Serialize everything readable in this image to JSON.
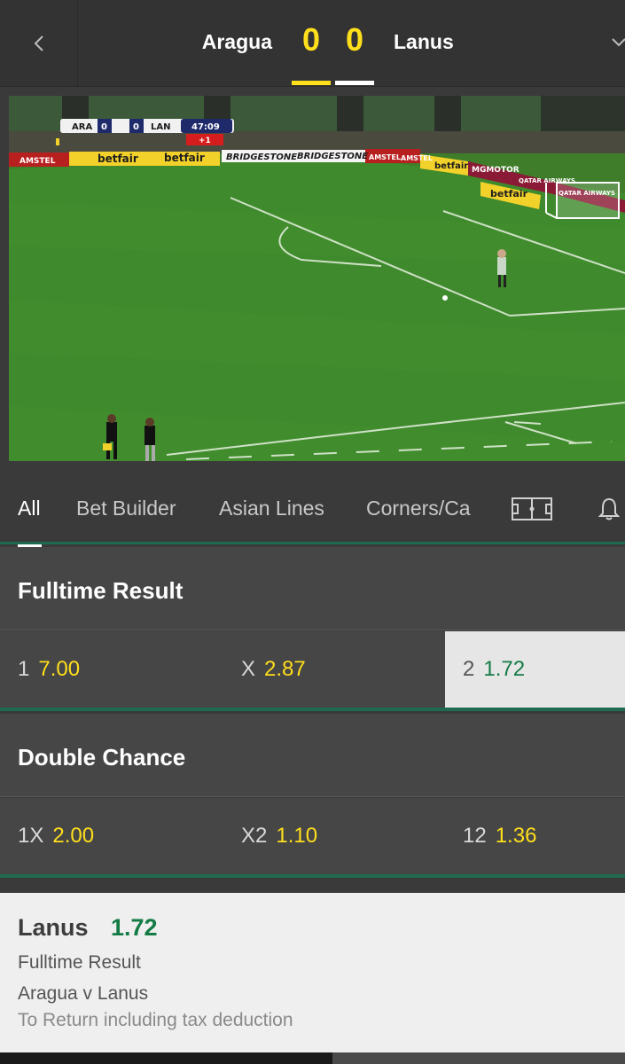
{
  "match": {
    "home_team": "Aragua",
    "away_team": "Lanus",
    "home_score": "0",
    "away_score": "0"
  },
  "video": {
    "overlay_home": "ARA",
    "overlay_home_score": "0",
    "overlay_away": "LAN",
    "overlay_away_score": "0",
    "overlay_clock": "47:09",
    "overlay_added": "+1",
    "board_texts": [
      "AMSTEL",
      "betfair",
      "betfair",
      "BRIDGESTONE",
      "BRIDGESTONE",
      "AMSTEL",
      "AMSTEL",
      "betfair",
      "MGMOTOR",
      "QATAR AIRWAYS",
      "betfair",
      "QATAR AIRWAYS",
      "AMSTEL"
    ]
  },
  "tabs": [
    {
      "label": "All",
      "active": true
    },
    {
      "label": "Bet Builder"
    },
    {
      "label": "Asian Lines"
    },
    {
      "label": "Corners/Ca"
    }
  ],
  "icons": {
    "back": "chevron-left-icon",
    "more": "chevron-down-icon",
    "pitch": "pitch-icon",
    "alerts": "bell-icon"
  },
  "markets": [
    {
      "title": "Fulltime Result",
      "odds": [
        {
          "label": "1",
          "value": "7.00"
        },
        {
          "label": "X",
          "value": "2.87"
        },
        {
          "label": "2",
          "value": "1.72",
          "selected": true
        }
      ]
    },
    {
      "title": "Double Chance",
      "odds": [
        {
          "label": "1X",
          "value": "2.00"
        },
        {
          "label": "X2",
          "value": "1.10"
        },
        {
          "label": "12",
          "value": "1.36"
        }
      ]
    }
  ],
  "betslip": {
    "selection": "Lanus",
    "odds": "1.72",
    "market": "Fulltime Result",
    "event": "Aragua v Lanus",
    "return_text": "To Return including tax deduction"
  },
  "colors": {
    "accent_yellow": "#ffdf1b",
    "accent_green": "#147b45",
    "divider_green": "#1e6b4f",
    "panel": "#464646"
  }
}
